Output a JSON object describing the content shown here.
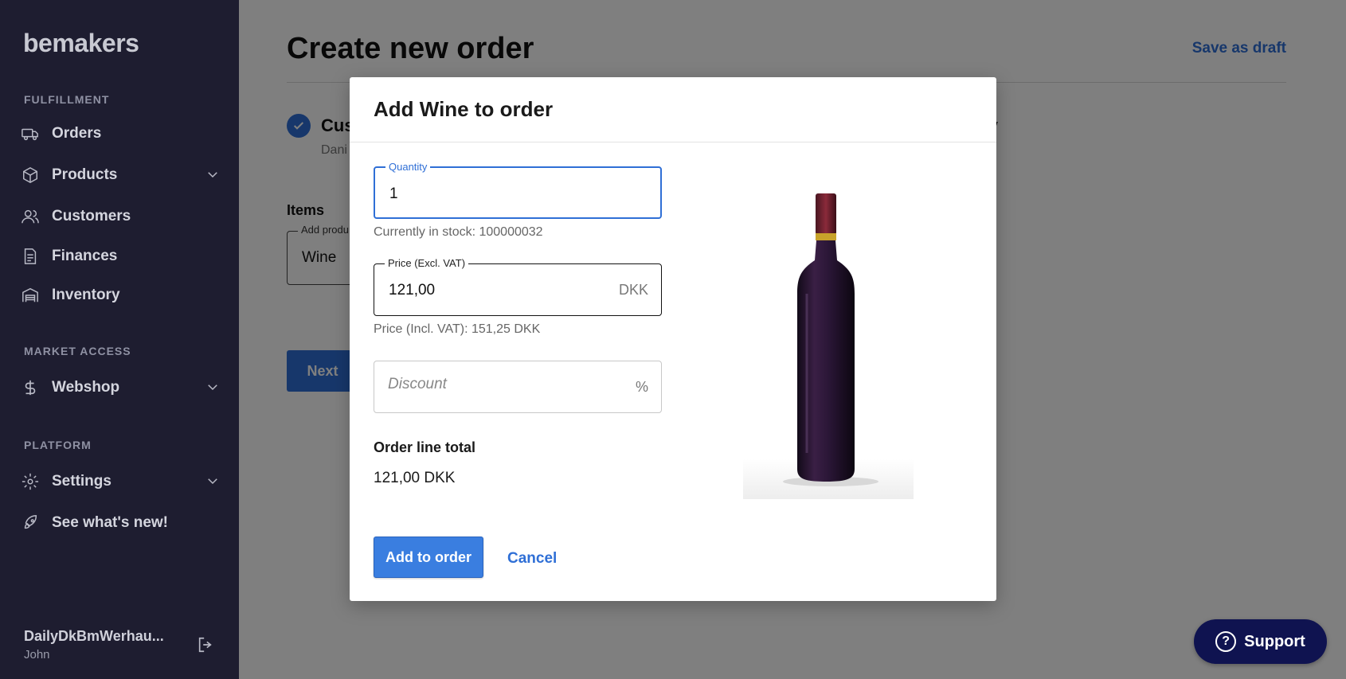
{
  "app": {
    "logo": "bemakers"
  },
  "sidebar": {
    "sections": [
      {
        "title": "FULFILLMENT"
      },
      {
        "title": "MARKET ACCESS"
      },
      {
        "title": "PLATFORM"
      }
    ],
    "items": [
      {
        "label": "Orders",
        "icon": "truck-icon"
      },
      {
        "label": "Products",
        "icon": "box-icon",
        "expandable": true
      },
      {
        "label": "Customers",
        "icon": "users-icon"
      },
      {
        "label": "Finances",
        "icon": "document-icon"
      },
      {
        "label": "Inventory",
        "icon": "warehouse-icon"
      },
      {
        "label": "Webshop",
        "icon": "dollar-icon",
        "expandable": true
      },
      {
        "label": "Settings",
        "icon": "gear-icon",
        "expandable": true
      },
      {
        "label": "See what's new!",
        "icon": "rocket-icon"
      }
    ],
    "user": {
      "name": "DailyDkBmWerhau...",
      "sub": "John"
    }
  },
  "page": {
    "title": "Create new order",
    "save_draft": "Save as draft",
    "step1_label": "Cus",
    "step1_sub": "Dani",
    "step_right": "ary",
    "items_label": "Items",
    "add_product_legend": "Add produ",
    "add_product_value": "Wine",
    "next_label": "Next"
  },
  "modal": {
    "title": "Add Wine to order",
    "quantity": {
      "legend": "Quantity",
      "value": "1"
    },
    "stock_text": "Currently in stock: 100000032",
    "price": {
      "legend": "Price (Excl. VAT)",
      "value": "121,00",
      "suffix": "DKK"
    },
    "price_incl_text": "Price (Incl. VAT): 151,25 DKK",
    "discount": {
      "placeholder": "Discount",
      "suffix": "%"
    },
    "order_line_total_label": "Order line total",
    "order_line_total_value": "121,00 DKK",
    "add_button": "Add to order",
    "cancel_button": "Cancel"
  },
  "support": {
    "label": "Support",
    "icon": "question-icon"
  },
  "colors": {
    "sidebar_bg": "#1e1d30",
    "accent": "#2f6fd6",
    "support_bg": "#0f1350"
  }
}
